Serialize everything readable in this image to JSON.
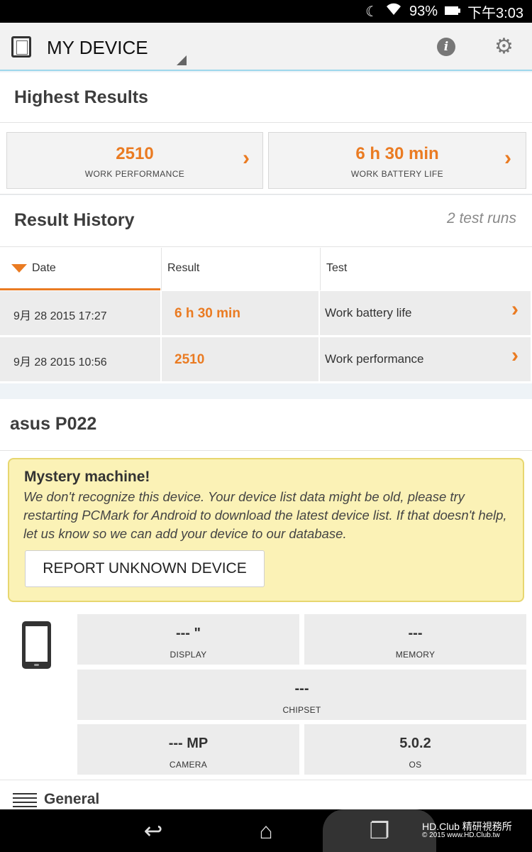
{
  "status_bar": {
    "battery": "93%",
    "time": "下午3:03"
  },
  "app_bar": {
    "title": "MY DEVICE"
  },
  "highest_results": {
    "heading": "Highest Results",
    "cards": [
      {
        "value": "2510",
        "label": "WORK PERFORMANCE"
      },
      {
        "value": "6 h 30 min",
        "label": "WORK BATTERY LIFE"
      }
    ]
  },
  "result_history": {
    "heading": "Result History",
    "runs": "2 test runs",
    "columns": [
      "Date",
      "Result",
      "Test"
    ],
    "rows": [
      {
        "date": "9月 28 2015 17:27",
        "result": "6 h 30 min",
        "test": "Work battery life"
      },
      {
        "date": "9月 28 2015 10:56",
        "result": "2510",
        "test": "Work performance"
      }
    ]
  },
  "device": {
    "name": "asus P022",
    "notice_title": "Mystery machine!",
    "notice_text": "We don't recognize this device. Your device list data might be old, please try restarting PCMark for Android to download the latest device list. If that doesn't help, let us know so we can add your device to our database.",
    "report_button": "REPORT UNKNOWN DEVICE",
    "specs": {
      "display": {
        "value": "--- \"",
        "label": "DISPLAY"
      },
      "memory": {
        "value": "---",
        "label": "MEMORY"
      },
      "chipset": {
        "value": "---",
        "label": "CHIPSET"
      },
      "camera": {
        "value": "--- MP",
        "label": "CAMERA"
      },
      "os": {
        "value": "5.0.2",
        "label": "OS"
      }
    },
    "general_label": "General"
  },
  "watermark": {
    "line1": "HD.Club 精研視務所",
    "line2": "© 2015 www.HD.Club.tw"
  },
  "colors": {
    "accent": "#ea7b22",
    "notice_bg": "#fbf2b6",
    "appbar_line": "#9ed7ec"
  }
}
